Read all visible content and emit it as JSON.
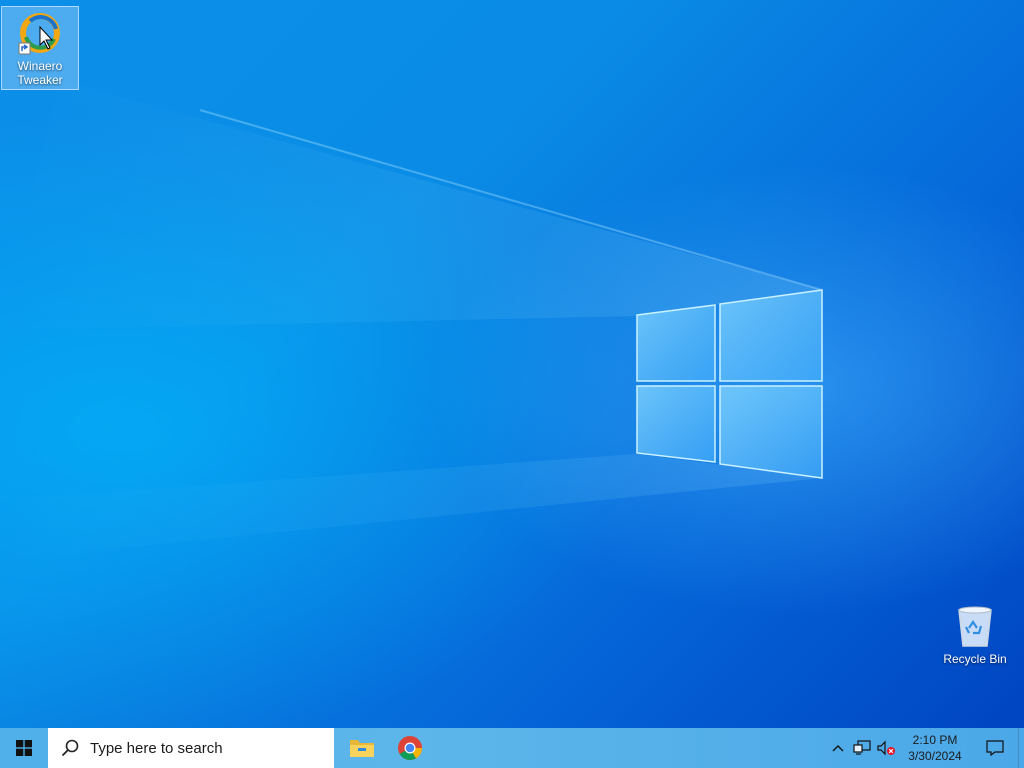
{
  "desktop": {
    "icons": [
      {
        "label": "Winaero Tweaker",
        "icon": "winaero-tweaker-icon",
        "selected": true
      },
      {
        "label": "Recycle Bin",
        "icon": "recycle-bin-icon",
        "selected": false
      }
    ]
  },
  "taskbar": {
    "start_icon": "windows-logo-icon",
    "search": {
      "placeholder": "Type here to search",
      "icon": "search-icon"
    },
    "pinned_apps": [
      {
        "name": "File Explorer",
        "icon": "file-explorer-icon"
      },
      {
        "name": "Google Chrome",
        "icon": "chrome-icon"
      }
    ],
    "tray": {
      "icons": [
        "chevron-up-icon",
        "network-icon",
        "volume-muted-icon"
      ],
      "time": "2:10 PM",
      "date": "3/30/2024",
      "notification_icon": "notification-icon"
    }
  },
  "colors": {
    "accent": "#0a78e6",
    "taskbar": "#5db6ea"
  }
}
